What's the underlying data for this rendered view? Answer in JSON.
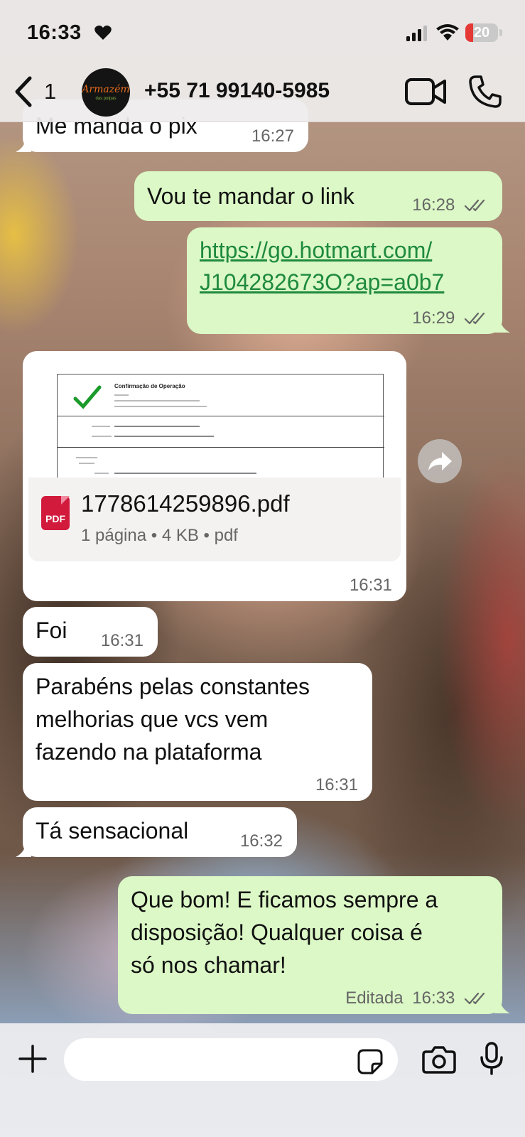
{
  "status": {
    "time": "16:33",
    "battery": "20"
  },
  "header": {
    "unread_count": "1",
    "contact": "+55 71 99140-5985",
    "avatar_name": "Armazém",
    "avatar_sub": "das polpas",
    "icons": [
      "chevron-left-icon",
      "video-icon",
      "phone-icon"
    ]
  },
  "messages": [
    {
      "side": "in",
      "text": "Me manda o pix",
      "time": "16:27"
    },
    {
      "side": "out",
      "text": "Vou te mandar o link",
      "time": "16:28",
      "status": "read"
    },
    {
      "side": "out",
      "link_line1": "https://go.hotmart.com/",
      "link_line2": "J104282673O?ap=a0b7",
      "time": "16:29",
      "status": "read"
    },
    {
      "side": "in",
      "type": "document",
      "file_name": "1778614259896.pdf",
      "file_meta": "1 página • 4 KB • pdf",
      "file_icon_label": "PDF",
      "time": "16:31"
    },
    {
      "side": "in",
      "text": "Foi",
      "time": "16:31"
    },
    {
      "side": "in",
      "line1": "Parabéns pelas constantes",
      "line2": "melhorias que vcs vem",
      "line3": "fazendo na plataforma",
      "time": "16:31"
    },
    {
      "side": "in",
      "text": "Tá sensacional",
      "time": "16:32"
    },
    {
      "side": "out",
      "line1": "Que bom! E ficamos sempre a",
      "line2": "disposição! Qualquer coisa é",
      "line3": "só nos chamar!",
      "edited": "Editada",
      "time": "16:33",
      "status": "read"
    }
  ],
  "pdf_preview": {
    "title": "Confirmação de Operação"
  },
  "composer": {
    "placeholder": ""
  },
  "colors": {
    "outgoing_bubble": "#dbf8c6",
    "incoming_bubble": "#ffffff",
    "link": "#1f8a3d",
    "pdf_icon": "#d11a3c"
  }
}
